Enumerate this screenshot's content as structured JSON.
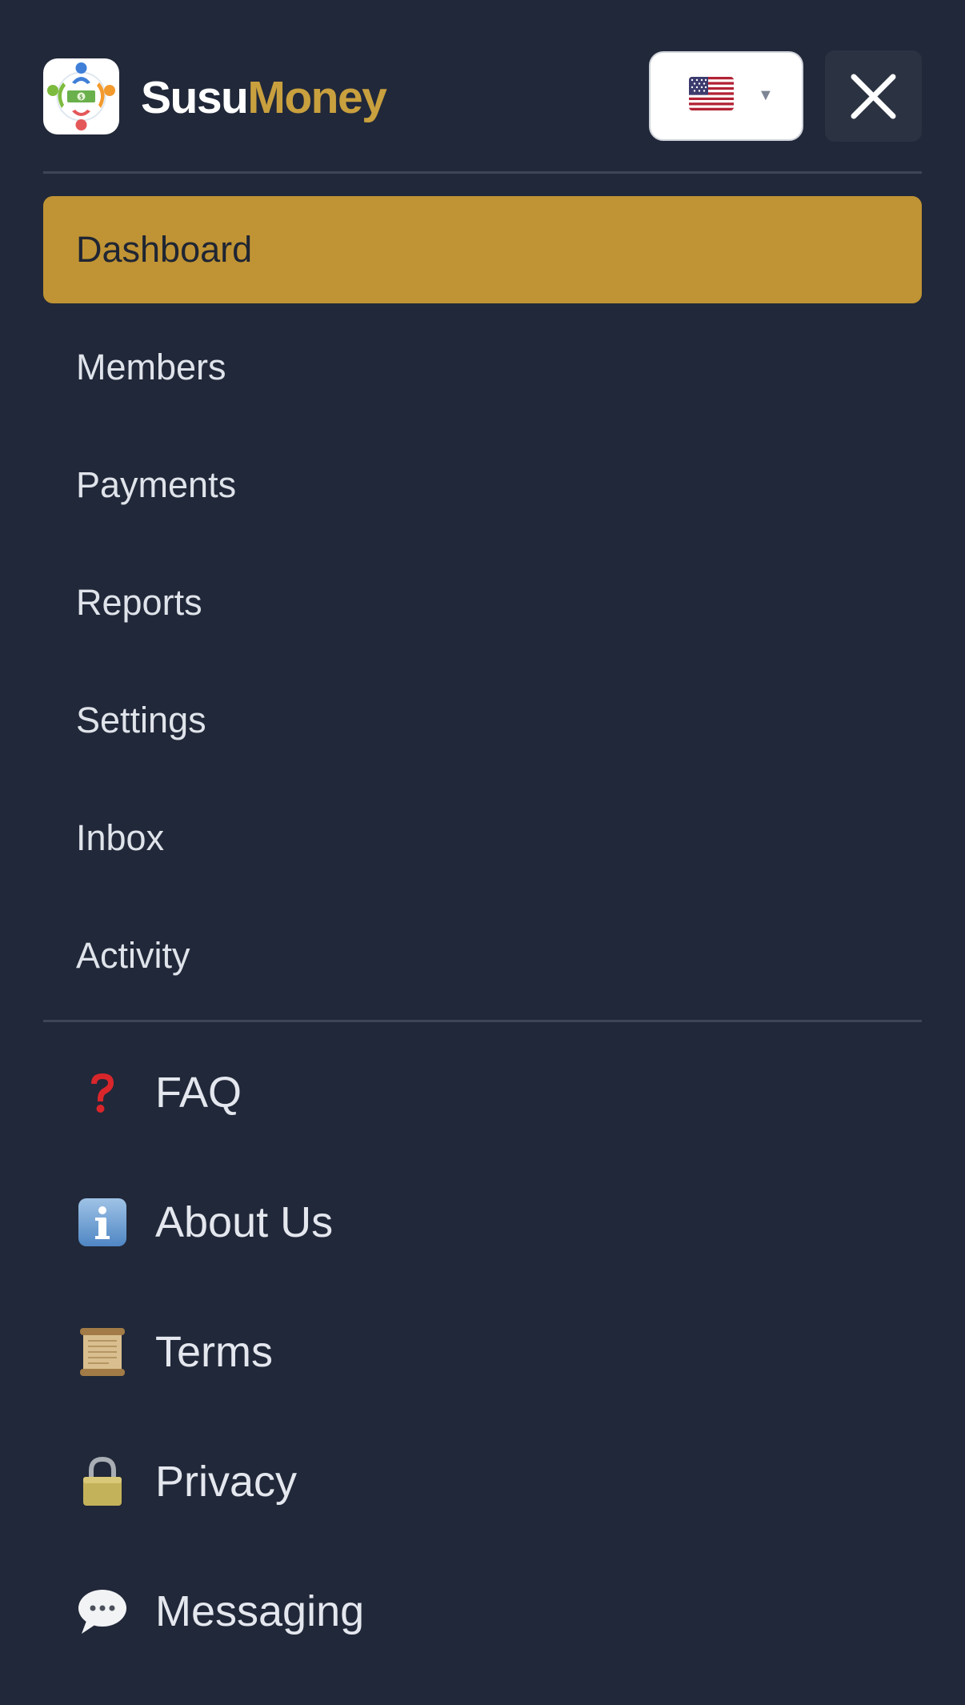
{
  "header": {
    "brand_part1": "Susu",
    "brand_part2": "Money",
    "logo_icon": "susu-circle-logo-icon",
    "language_flag": "us-flag-icon",
    "close_icon": "close-icon"
  },
  "nav": {
    "items": [
      {
        "label": "Dashboard",
        "active": true
      },
      {
        "label": "Members"
      },
      {
        "label": "Payments"
      },
      {
        "label": "Reports"
      },
      {
        "label": "Settings"
      },
      {
        "label": "Inbox"
      },
      {
        "label": "Activity"
      }
    ]
  },
  "footer": {
    "items": [
      {
        "label": "FAQ",
        "icon": "question-icon"
      },
      {
        "label": "About Us",
        "icon": "info-icon"
      },
      {
        "label": "Terms",
        "icon": "scroll-icon"
      },
      {
        "label": "Privacy",
        "icon": "lock-icon"
      },
      {
        "label": "Messaging",
        "icon": "speech-bubble-icon"
      }
    ]
  },
  "colors": {
    "background": "#212839",
    "accent": "#c09434",
    "brand_gold": "#c9a03e"
  }
}
